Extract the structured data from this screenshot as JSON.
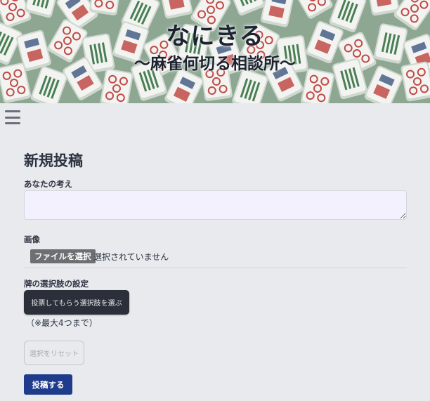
{
  "header": {
    "title": "なにきる",
    "subtitle": "〜麻雀何切る相談所〜"
  },
  "nav": {
    "menu_icon": "hamburger-menu-icon"
  },
  "form": {
    "page_title": "新規投稿",
    "thoughts_label": "あなたの考え",
    "thoughts_value": "",
    "image_label": "画像",
    "file_button_label": "ファイルを選択",
    "file_status": "選択されていません",
    "choices_label": "牌の選択肢の設定",
    "choose_button_label": "投票してもらう選択肢を選ぶ",
    "limit_note": "（※最大4つまで）",
    "reset_button_label": "選択をリセット",
    "submit_button_label": "投稿する"
  },
  "colors": {
    "background": "#e8eaee",
    "submit": "#1e3b8c",
    "choose": "#2b2f3a",
    "textarea": "#f2f1fd"
  }
}
